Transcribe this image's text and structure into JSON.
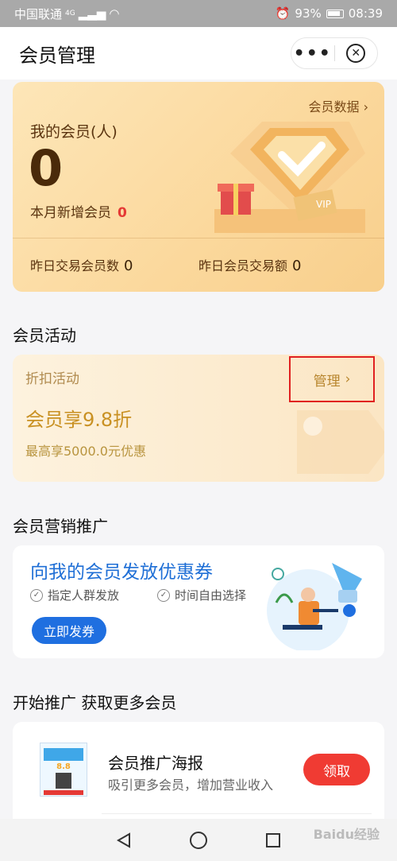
{
  "status": {
    "carrier": "中国联通",
    "network": "4G",
    "battery": "93%",
    "time": "08:39"
  },
  "nav": {
    "title": "会员管理",
    "more": "•••",
    "close": "✕"
  },
  "summary": {
    "data_link": "会员数据",
    "my_members_label": "我的会员(人)",
    "my_members_value": "0",
    "month_new_label": "本月新增会员",
    "month_new_value": "0",
    "yesterday_members_label": "昨日交易会员数",
    "yesterday_members_value": "0",
    "yesterday_amount_label": "昨日会员交易额",
    "yesterday_amount_value": "0",
    "vip_text": "VIP"
  },
  "activities": {
    "section_title": "会员活动",
    "type": "折扣活动",
    "manage": "管理",
    "main": "会员享9.8折",
    "sub": "最高享5000.0元优惠"
  },
  "marketing": {
    "section_title": "会员营销推广",
    "heading": "向我的会员发放优惠券",
    "feature1": "指定人群发放",
    "feature2": "时间自由选择",
    "button": "立即发券"
  },
  "promotion": {
    "section_title": "开始推广 获取更多会员",
    "poster_name": "会员推广海报",
    "poster_desc": "吸引更多会员，增加营业收入",
    "poster_button": "领取",
    "thumb_value": "8.8"
  },
  "watermark": "Baidu经验",
  "colors": {
    "accent_blue": "#1f6fe0",
    "accent_red": "#f03b33",
    "gold_text": "#c99123"
  }
}
